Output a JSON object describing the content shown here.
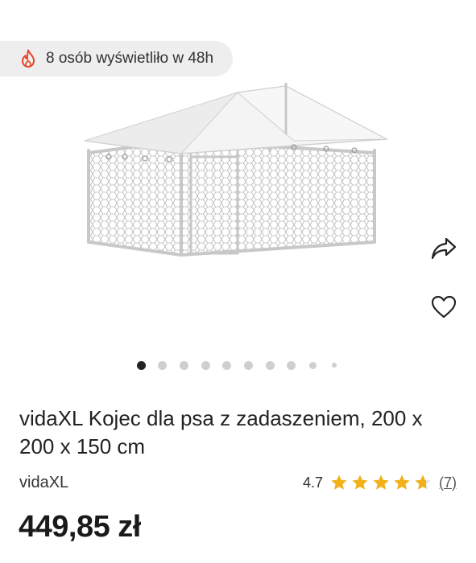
{
  "views_badge": {
    "text": "8 osób wyświetliło w 48h",
    "icon": "flame-icon",
    "icon_color": "#e8452a"
  },
  "gallery": {
    "total_images": 10,
    "active_index": 0,
    "image": "dog-kennel-with-roof"
  },
  "actions": {
    "share_icon": "share-icon",
    "favorite_icon": "heart-icon"
  },
  "product": {
    "title": "vidaXL Kojec dla psa z zadaszeniem, 200 x 200 x 150 cm",
    "brand": "vidaXL",
    "rating": "4.7",
    "rating_stars": 4.7,
    "review_count": "(7)",
    "price": "449,85 zł"
  },
  "colors": {
    "star": "#f2b11a",
    "dot_active": "#222222",
    "dot_inactive": "#cfcfcf"
  }
}
